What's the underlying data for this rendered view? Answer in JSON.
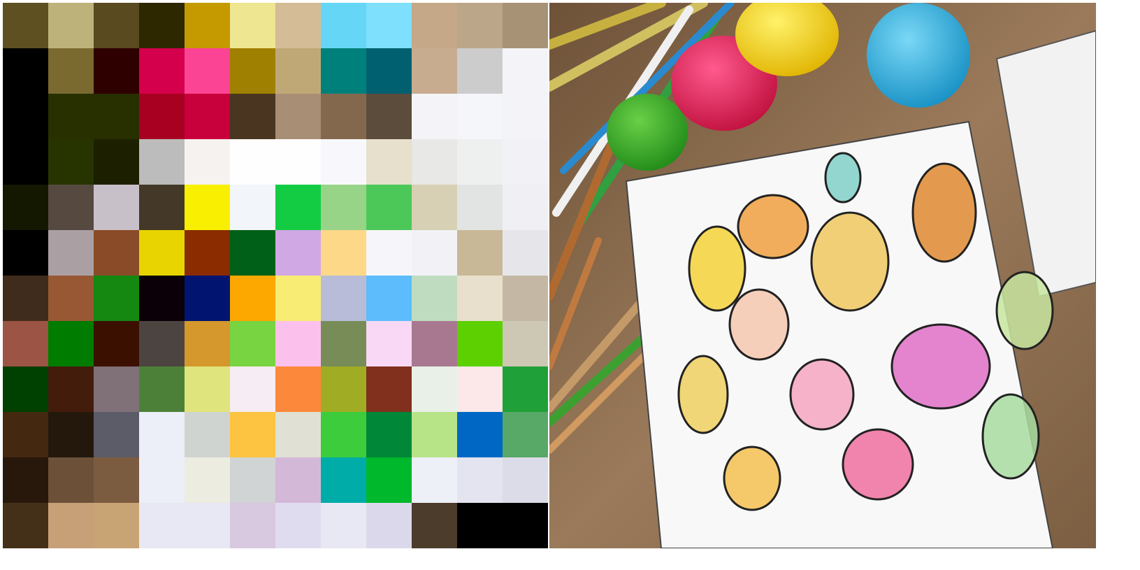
{
  "mosaic": {
    "rows": 12,
    "cols": 12,
    "colors": [
      [
        "#5e5020",
        "#bcb27a",
        "#5a4a20",
        "#2e2800",
        "#c49a00",
        "#eee690",
        "#d4bc96",
        "#66d6f6",
        "#7ee0fc",
        "#c4a888",
        "#bca68a",
        "#a89276"
      ],
      [
        "#000000",
        "#7a6a30",
        "#2e0000",
        "#d4004c",
        "#fc4494",
        "#a08000",
        "#c0a876",
        "#00807a",
        "#006070",
        "#c8ac90",
        "#cccccc",
        "#f4f4f8"
      ],
      [
        "#000000",
        "#283000",
        "#283000",
        "#a80020",
        "#c8003c",
        "#4a3620",
        "#a88e74",
        "#84684e",
        "#5c4c3c",
        "#f4f4f8",
        "#f4f6fa",
        "#f4f4f8"
      ],
      [
        "#000000",
        "#283400",
        "#1c2000",
        "#bcbcbc",
        "#f6f2f0",
        "#fefefe",
        "#fefefe",
        "#f8f8fc",
        "#e6e0cc",
        "#e8e8e6",
        "#eef0f0",
        "#f2f2f6"
      ],
      [
        "#141800",
        "#564a40",
        "#c8c0c8",
        "#443828",
        "#f8f000",
        "#f2f6fa",
        "#14cc44",
        "#98d488",
        "#4cc858",
        "#d8d0b4",
        "#e2e4e4",
        "#f0f0f4"
      ],
      [
        "#000000",
        "#aaa0a4",
        "#8a4c28",
        "#e8d400",
        "#8a2c00",
        "#006018",
        "#d0a8e4",
        "#fcd888",
        "#f6f6fa",
        "#f2f2f6",
        "#c8b898",
        "#e6e6ea"
      ],
      [
        "#402c1c",
        "#985834",
        "#148810",
        "#0c0008",
        "#001470",
        "#fca800",
        "#f8ec74",
        "#b8bcd8",
        "#5cbcfc",
        "#c0dcc0",
        "#e8e0cc",
        "#c4b8a4"
      ],
      [
        "#9c5444",
        "#007c00",
        "#3c1000",
        "#4c4440",
        "#d4982c",
        "#78d440",
        "#fcc0ec",
        "#788c58",
        "#f8d8f4",
        "#a87890",
        "#5cd000",
        "#ccc8b4"
      ],
      [
        "#004000",
        "#441c0c",
        "#807078",
        "#4c8038",
        "#e0e47c",
        "#f6ecf4",
        "#fc883c",
        "#a0ac24",
        "#80301c",
        "#e8f0e8",
        "#fce8e8",
        "#20a038"
      ],
      [
        "#442810",
        "#24180c",
        "#5c5c68",
        "#eceef8",
        "#d0d4d0",
        "#fcc440",
        "#e0e0d4",
        "#3ccc3c",
        "#008838",
        "#b8e488",
        "#0068c4",
        "#58a868"
      ],
      [
        "#28180c",
        "#6c5038",
        "#7c5c40",
        "#eceef8",
        "#ecece0",
        "#d0d4d4",
        "#d4b8d8",
        "#00aca8",
        "#00b82c",
        "#eef0f8",
        "#e4e4f0",
        "#dcdce8"
      ],
      [
        "#443018",
        "#c8a078",
        "#c8a474",
        "#e8e8f4",
        "#e8e8f4",
        "#d8c8e0",
        "#e0dcf0",
        "#e8e8f4",
        "#dcd8ec",
        "#4c3c2c",
        "#000000",
        "#000000"
      ]
    ]
  },
  "photo": {
    "colors": {
      "wood": "#8a6a4c",
      "egg_yellow": "#f2d51a",
      "egg_blue": "#2fb4e0",
      "egg_pink": "#e0205e",
      "egg_green": "#3eaa30",
      "paper": "#f8f8f8"
    }
  }
}
